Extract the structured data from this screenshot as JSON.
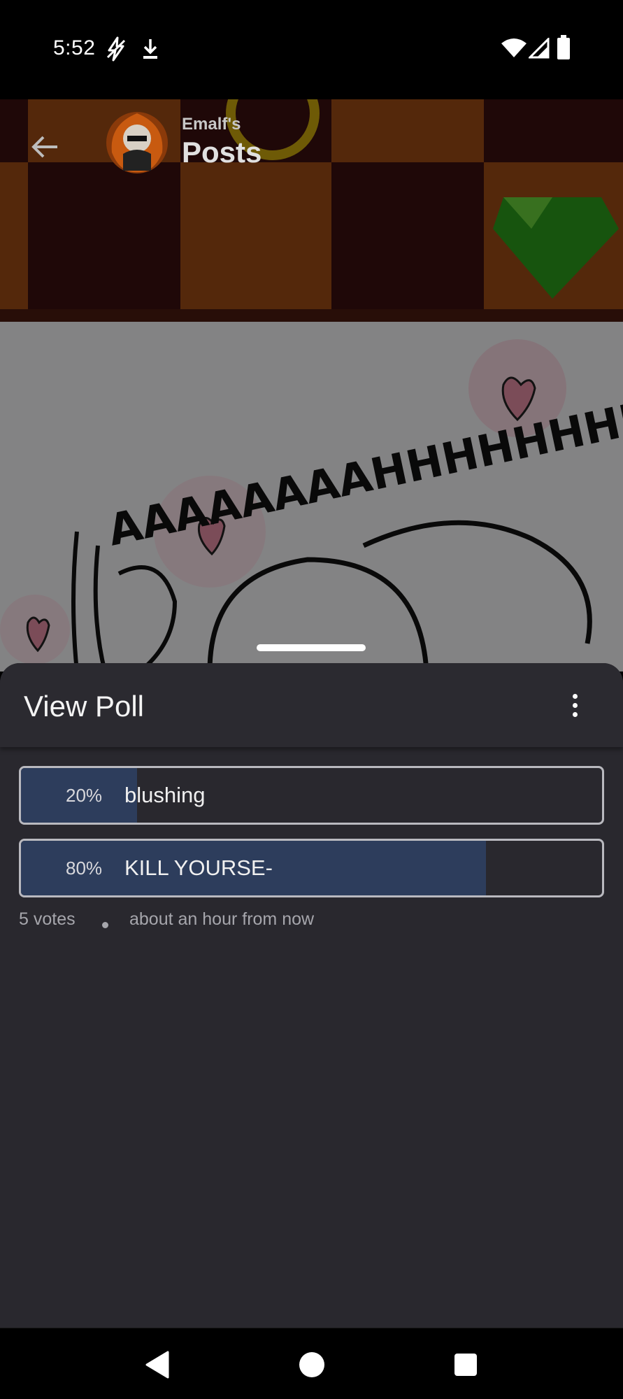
{
  "status_bar": {
    "time": "5:52",
    "left_icons": [
      "flash-off-icon",
      "download-icon"
    ],
    "right_icons": [
      "wifi-icon",
      "cell-signal-icon",
      "battery-icon"
    ]
  },
  "header": {
    "subtitle": "Emalf's",
    "title": "Posts",
    "back_icon": "arrow-left-icon"
  },
  "post_image": {
    "text": "AAAAAAAAHHHHHHHHH"
  },
  "sheet": {
    "title": "View Poll",
    "menu_icon": "more-vertical-icon",
    "options": [
      {
        "percent_label": "20%",
        "label": "blushing",
        "fraction": 0.2
      },
      {
        "percent_label": "80%",
        "label": "KILL YOURSE-",
        "fraction": 0.8
      }
    ],
    "votes": "5 votes",
    "time": "about an hour from now"
  },
  "nav_bar": {
    "back_icon": "triangle-back-icon",
    "home_icon": "circle-home-icon",
    "recents_icon": "square-recents-icon"
  },
  "colors": {
    "sheet_bg": "#29282e",
    "poll_fill": "#2d3d5c",
    "poll_border": "#b9b9bf",
    "meta_text": "#a6a6ac"
  }
}
